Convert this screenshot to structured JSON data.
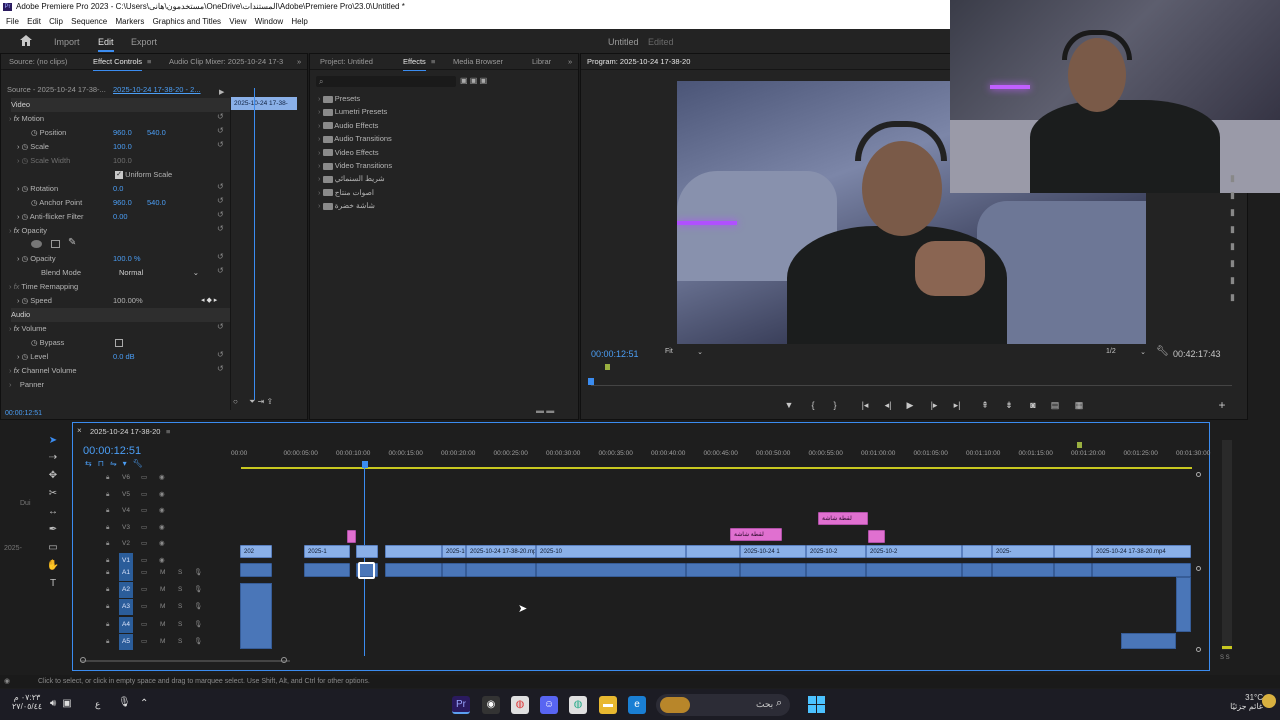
{
  "title_bar": {
    "text": "Adobe Premiere Pro 2023 - C:\\Users\\مستخدمون\\هانى\\OneDrive\\المستندات\\Adobe\\Premiere Pro\\23.0\\Untitled *"
  },
  "menu": [
    "File",
    "Edit",
    "Clip",
    "Sequence",
    "Markers",
    "Graphics and Titles",
    "View",
    "Window",
    "Help"
  ],
  "workspace": {
    "tabs": [
      "Import",
      "Edit",
      "Export"
    ],
    "active": "Edit",
    "doc_title": "Untitled",
    "doc_state": "Edited"
  },
  "source_panel": {
    "tabs": [
      "Source: (no clips)",
      "Effect Controls",
      "Audio Clip Mixer: 2025-10-24 17-3",
      "Project: Untitled",
      "Effects",
      "Media Browser",
      "Librar"
    ],
    "source_seq": "Source - 2025-10-24 17-38-...",
    "target_seq": "2025-10-24 17-38-20 - 2...",
    "mini_clip": "2025-10-24 17-38-",
    "timecode": "00:00:12:51"
  },
  "effect_controls": {
    "video_header": "Video",
    "motion": "Motion",
    "position_label": "Position",
    "position_x": "960.0",
    "position_y": "540.0",
    "scale_label": "Scale",
    "scale_value": "100.0",
    "scale_width_label": "Scale Width",
    "scale_width_value": "100.0",
    "uniform_scale": "Uniform Scale",
    "rotation_label": "Rotation",
    "rotation_value": "0.0",
    "anchor_label": "Anchor Point",
    "anchor_x": "960.0",
    "anchor_y": "540.0",
    "antiflicker_label": "Anti-flicker Filter",
    "antiflicker_value": "0.00",
    "opacity_group": "Opacity",
    "opacity_label": "Opacity",
    "opacity_value": "100.0 %",
    "blend_label": "Blend Mode",
    "blend_value": "Normal",
    "time_remap": "Time Remapping",
    "speed_label": "Speed",
    "speed_value": "100.00%",
    "audio_header": "Audio",
    "volume_group": "Volume",
    "bypass_label": "Bypass",
    "level_label": "Level",
    "level_value": "0.0 dB",
    "channel_volume": "Channel Volume",
    "panner": "Panner"
  },
  "effects_panel": {
    "folders": [
      "Presets",
      "Lumetri Presets",
      "Audio Effects",
      "Audio Transitions",
      "Video Effects",
      "Video Transitions",
      "شريط السنمائي",
      "اصوات منتاج",
      "شاشة خضرة"
    ]
  },
  "program_monitor": {
    "title": "Program: 2025-10-24 17-38-20",
    "timecode": "00:00:12:51",
    "fit": "Fit",
    "resolution": "1/2",
    "duration": "00:42:17:43"
  },
  "timeline": {
    "sequence_name": "2025-10-24 17-38-20",
    "timecode": "00:00:12:51",
    "ruler": [
      "00:00",
      "00:00:05:00",
      "00:00:10:00",
      "00:00:15:00",
      "00:00:20:00",
      "00:00:25:00",
      "00:00:30:00",
      "00:00:35:00",
      "00:00:40:00",
      "00:00:45:00",
      "00:00:50:00",
      "00:00:55:00",
      "00:01:00:00",
      "00:01:05:00",
      "00:01:10:00",
      "00:01:15:00",
      "00:01:20:00",
      "00:01:25:00",
      "00:01:30:00"
    ],
    "video_tracks": [
      "V6",
      "V5",
      "V4",
      "V3",
      "V2",
      "V1"
    ],
    "audio_tracks": [
      "A1",
      "A2",
      "A3",
      "A4",
      "A5"
    ],
    "m_label": "M",
    "s_label": "S",
    "v1_clips": [
      "202",
      "2025-1",
      "2025-10-24",
      "2025-10-24 17-38-20.mp4",
      "2025-10",
      "2025-10-24 1",
      "2025-10-2",
      "2025-10-2",
      "2025-",
      "2025-10-24 17-38-20.mp4"
    ],
    "pink_clips": [
      "لقطة شاشة",
      "لقطة شاشة"
    ],
    "left_label": "Dui",
    "left_label2": "2025-",
    "meter_labels": "S S"
  },
  "status_bar": {
    "text": "Click to select, or click in empty space and drag to marquee select. Use Shift, Alt, and Ctrl for other options."
  },
  "taskbar": {
    "search": "بحث",
    "clock_time": "٠٧:٢٣ م",
    "clock_date": "٢٧/٠٥/٤٤",
    "weather_temp": "31°C",
    "weather_desc": "غائم جزئيًا",
    "lang": "ع"
  }
}
